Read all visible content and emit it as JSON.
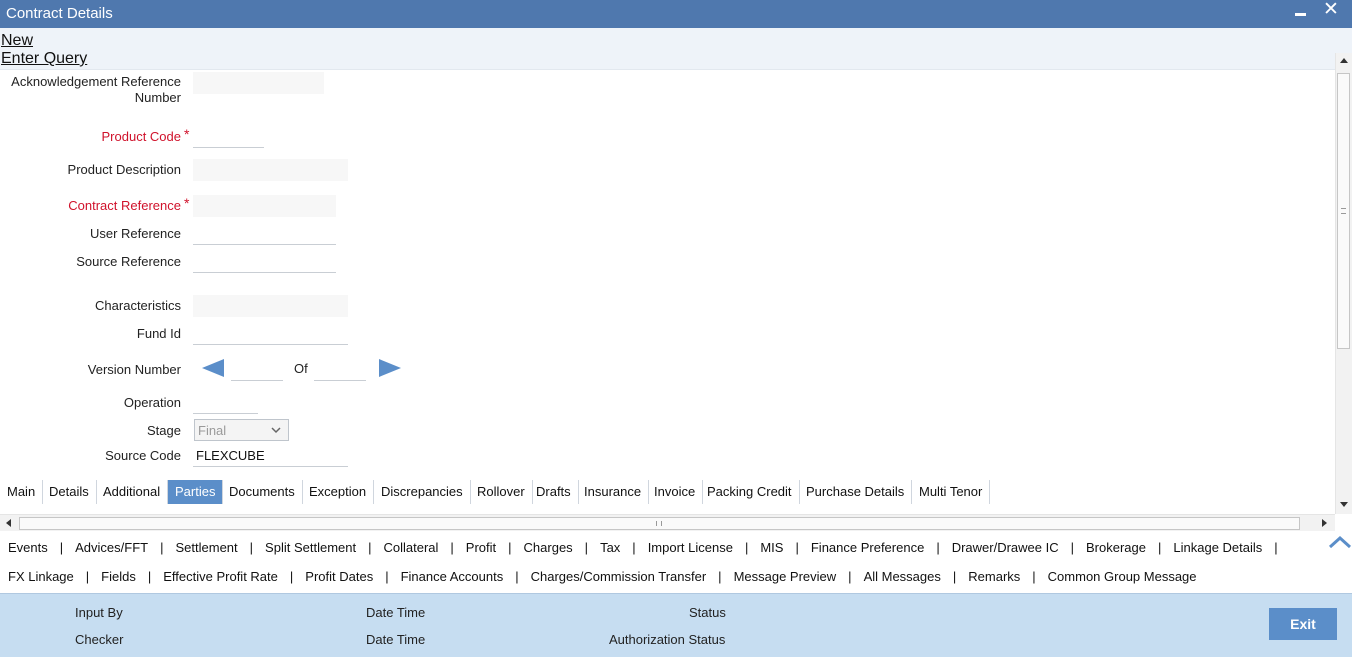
{
  "window": {
    "title": "Contract Details"
  },
  "toolbar": {
    "new": "New",
    "enter_query": "Enter Query"
  },
  "form": {
    "ack_ref_line1": "Acknowledgement Reference",
    "ack_ref_line2": "Number",
    "product_code": "Product Code",
    "product_description": "Product Description",
    "contract_reference": "Contract Reference",
    "user_reference": "User Reference",
    "source_reference": "Source Reference",
    "characteristics": "Characteristics",
    "fund_id": "Fund Id",
    "version_number": "Version Number",
    "of": "Of",
    "operation": "Operation",
    "stage": "Stage",
    "stage_value": "Final",
    "source_code": "Source Code",
    "source_code_value": "FLEXCUBE",
    "required_mark": "*"
  },
  "tabs": [
    "Main",
    "Details",
    "Additional",
    "Parties",
    "Documents",
    "Exception",
    "Discrepancies",
    "Rollover",
    "Drafts",
    "Insurance",
    "Invoice",
    "Packing Credit",
    "Purchase Details",
    "Multi Tenor"
  ],
  "active_tab": "Parties",
  "links_row1": [
    "Events",
    "Advices/FFT",
    "Settlement",
    "Split Settlement",
    "Collateral",
    "Profit",
    "Charges",
    "Tax",
    "Import License",
    "MIS",
    "Finance Preference",
    "Drawer/Drawee IC",
    "Brokerage",
    "Linkage Details"
  ],
  "links_row2": [
    "FX Linkage",
    "Fields",
    "Effective Profit Rate",
    "Profit Dates",
    "Finance Accounts",
    "Charges/Commission Transfer",
    "Message Preview",
    "All Messages",
    "Remarks",
    "Common Group Message"
  ],
  "footer": {
    "input_by": "Input By",
    "checker": "Checker",
    "date_time_1": "Date Time",
    "date_time_2": "Date Time",
    "status": "Status",
    "authorization_status": "Authorization Status",
    "exit": "Exit"
  },
  "colors": {
    "titlebar": "#4f78ae",
    "accent": "#5b8ec9",
    "footer": "#c6ddf1",
    "required": "#d0122b"
  }
}
